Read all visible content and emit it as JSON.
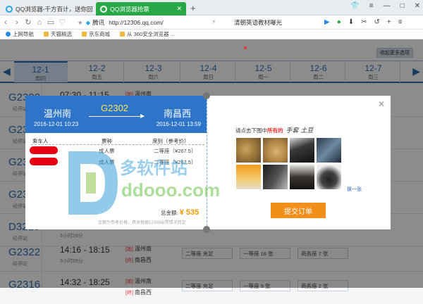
{
  "browser": {
    "tabs": [
      {
        "label": "QQ浏览器-千方百计，送你回家"
      },
      {
        "label": "QQ浏览器抢票"
      }
    ],
    "address": "http://12306.qq.com/",
    "address_tag": "腾讯",
    "search_text": "清朝英语教材曝光",
    "bookmarks": [
      "上网导航",
      "天猫精选",
      "京东商城",
      "从 360安全浏览器 ..."
    ]
  },
  "page": {
    "query_button": "收起更多选项",
    "dates": [
      {
        "date": "12-1",
        "weekday": "周四"
      },
      {
        "date": "12-2",
        "weekday": "周五"
      },
      {
        "date": "12-3",
        "weekday": "周六"
      },
      {
        "date": "12-4",
        "weekday": "周日"
      },
      {
        "date": "12-5",
        "weekday": "周一"
      },
      {
        "date": "12-6",
        "weekday": "周二"
      },
      {
        "date": "12-7",
        "weekday": "周三"
      }
    ],
    "rows": [
      {
        "train": "G2302",
        "stop": "经停站",
        "time": "07:30 - 11:15",
        "dur": "",
        "from": "温州南",
        "to": "南昌西",
        "seats": [
          "",
          "",
          ""
        ]
      },
      {
        "train": "G2316",
        "stop": "经停站",
        "time": "",
        "dur": "",
        "from": "",
        "to": "",
        "seats": [
          "",
          "",
          ""
        ]
      },
      {
        "train": "G2316",
        "stop": "经停站",
        "time": "",
        "dur": "",
        "from": "",
        "to": "",
        "seats": [
          "",
          "",
          ""
        ]
      },
      {
        "train": "G2316",
        "stop": "经停站",
        "time": "",
        "dur": "",
        "from": "",
        "to": "",
        "seats": [
          "",
          "",
          ""
        ]
      },
      {
        "train": "D3216",
        "stop": "经停站",
        "time": "",
        "dur": "3小时59分",
        "from": "",
        "to": "",
        "seats": [
          "",
          "",
          ""
        ]
      },
      {
        "train": "G2322",
        "stop": "经停站",
        "time": "14:16 - 18:15",
        "dur": "3小时59分",
        "from": "温州南",
        "to": "南昌西",
        "seats": [
          "二等座 充足",
          "一等座 16 张",
          "商务座 7 张"
        ]
      },
      {
        "train": "G2316",
        "stop": "经停站",
        "time": "14:32 - 18:25",
        "dur": "",
        "from": "温州南",
        "to": "南昌西",
        "seats": [
          "二等座 充足",
          "一等座 9 张",
          "商务座 2 张"
        ]
      }
    ]
  },
  "modal": {
    "from": "温州南",
    "to": "南昌西",
    "train": "G2302",
    "from_time": "2016-12-01 10:23",
    "to_time": "2016-12-01 13:59",
    "col_passenger": "乘车人",
    "col_type": "票种",
    "col_seat": "席别（参考价）",
    "passengers": [
      {
        "type": "成人票",
        "seat": "二等座（¥267.5）"
      },
      {
        "type": "成人票",
        "seat": "二等座（¥267.5）"
      }
    ],
    "total_label": "总金额:",
    "total": "¥ 535",
    "note": "金额为参考价格，具体根据12306出票情况而定",
    "captcha_prompt": "请点击下图中",
    "captcha_emphasis": "所有的",
    "captcha_words": "手套 土豆",
    "refresh": "换一张",
    "submit": "提交订单"
  },
  "watermark": {
    "brand": "多软件站",
    "domain": "ddooo.com"
  },
  "colors": {
    "accent": "#2e74c9",
    "tab_active": "#27a745",
    "submit": "#f28e1a",
    "price": "#f39800"
  }
}
